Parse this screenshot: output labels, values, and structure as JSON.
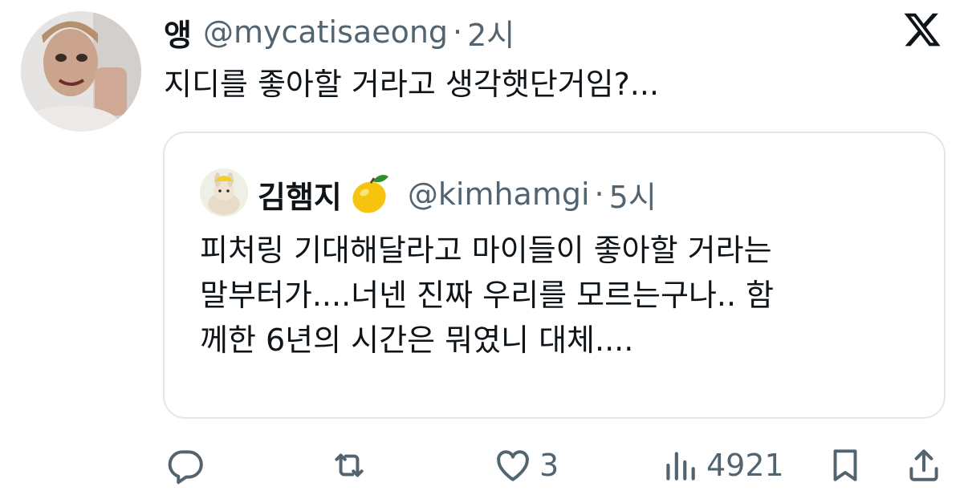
{
  "tweet": {
    "display_name": "앵",
    "handle": "@mycatisaeong",
    "separator": "·",
    "time": "2시",
    "text": "지디를 좋아할 거라고 생각햇단거임?..."
  },
  "quote": {
    "display_name": "김햄지",
    "name_emoji_icon": "lemon-icon",
    "handle": "@kimhamgi",
    "separator": "·",
    "time": "5시",
    "lines": [
      "피처링 기대해달라고 마이들이 좋아할 거라는",
      "말부터가....너넨 진짜 우리를 모르는구나.. 함",
      "께한 6년의 시간은 뭐였니 대체...."
    ]
  },
  "actions": {
    "reply_icon": "reply-icon",
    "retweet_icon": "retweet-icon",
    "like_icon": "heart-icon",
    "like_count": "3",
    "views_icon": "views-icon",
    "views_count": "4921",
    "bookmark_icon": "bookmark-icon",
    "share_icon": "share-icon"
  },
  "brand": {
    "logo": "x-logo-icon"
  },
  "colors": {
    "text": "#0f1419",
    "secondary": "#536471",
    "border": "#e3e7ea"
  }
}
